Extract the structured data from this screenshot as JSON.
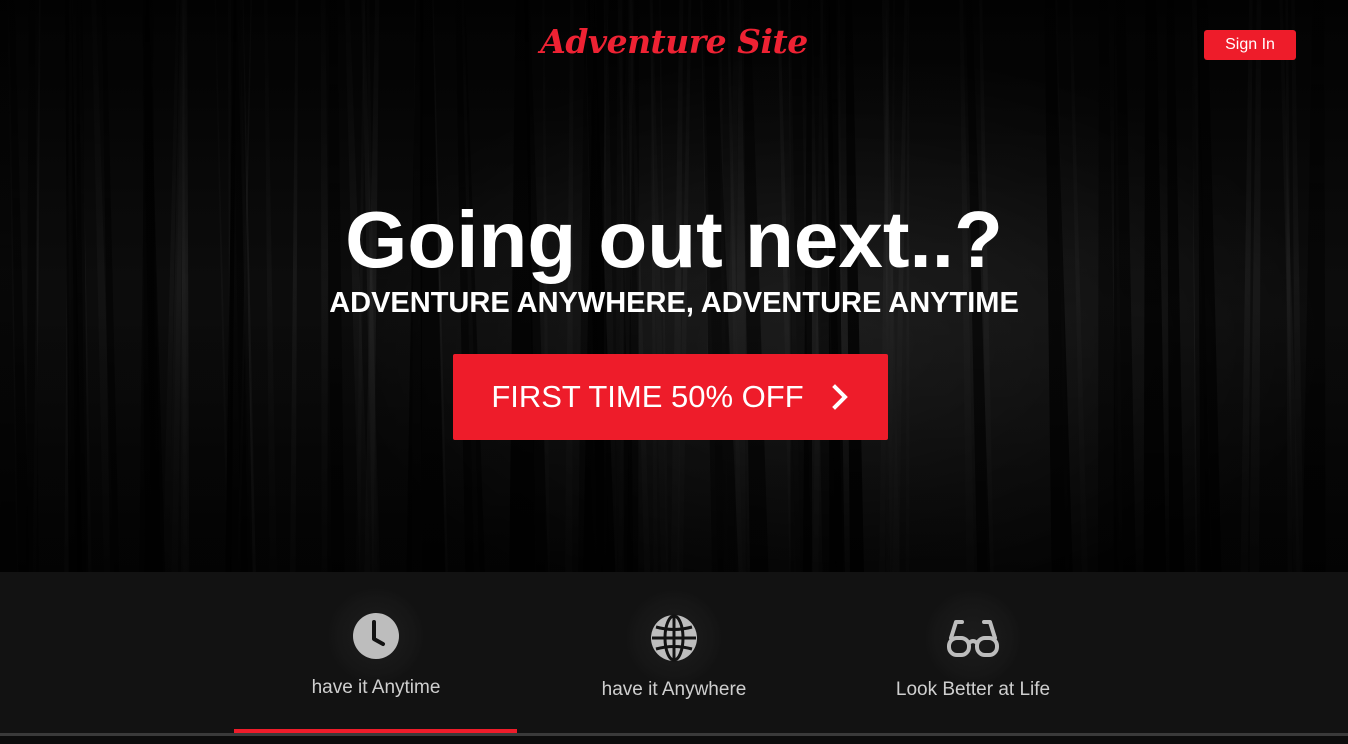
{
  "header": {
    "logo_text": "Adventure Site",
    "signin_label": "Sign In"
  },
  "hero": {
    "headline": "Going out next..?",
    "subheadline": "ADVENTURE ANYWHERE, ADVENTURE ANYTIME",
    "cta_label": "FIRST TIME 50% OFF",
    "cta_icon": "chevron-right-icon"
  },
  "features": [
    {
      "label": "have it Anytime",
      "icon": "clock-icon",
      "active": true
    },
    {
      "label": "have it Anywhere",
      "icon": "globe-icon",
      "active": false
    },
    {
      "label": "Look Better at Life",
      "icon": "glasses-icon",
      "active": false
    }
  ],
  "colors": {
    "accent": "#ee1c2a",
    "feature_bar_bg": "#121212",
    "feature_icon": "#bdbdbd",
    "feature_text": "#cfcfcf"
  }
}
